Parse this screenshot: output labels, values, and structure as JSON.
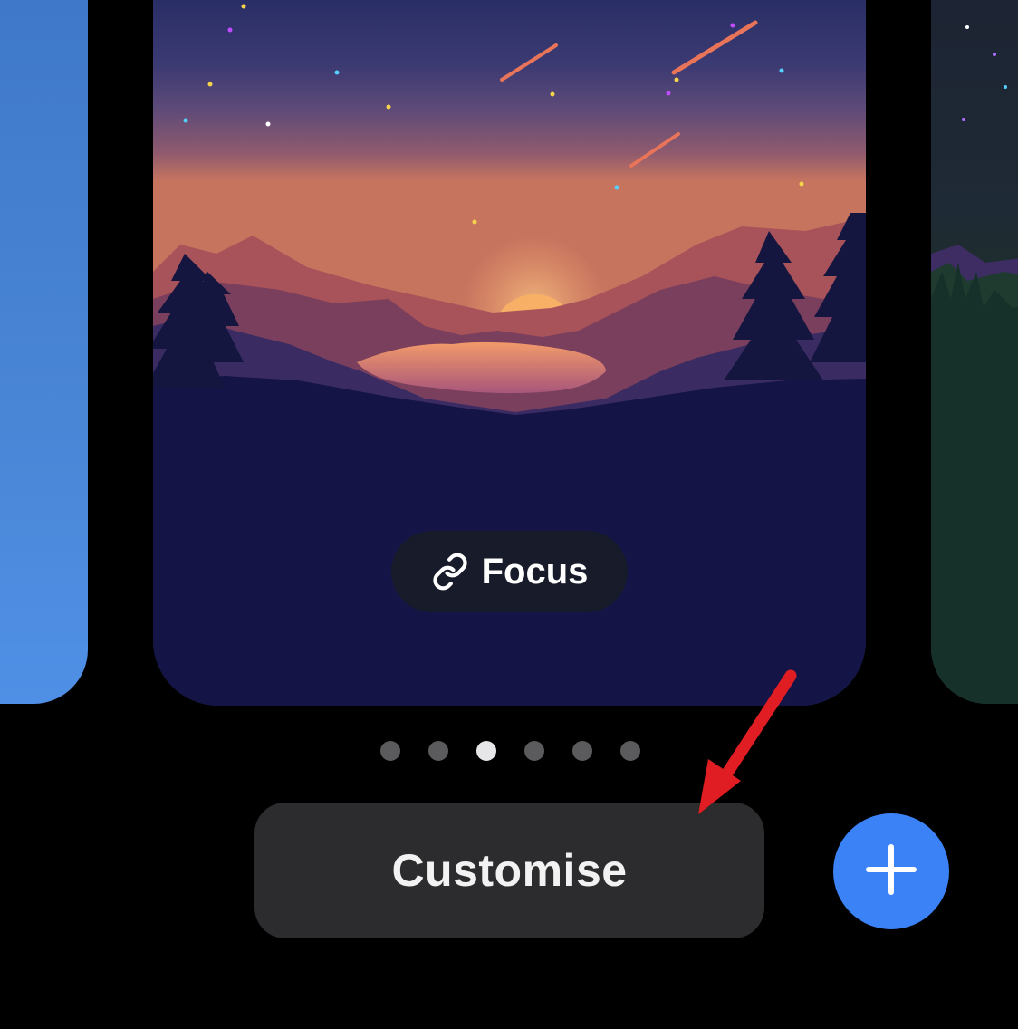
{
  "wallpaper_gallery": {
    "focus_label": "Focus",
    "page_indicator": {
      "count": 6,
      "active_index": 2
    },
    "customise_label": "Customise",
    "add_button_icon": "plus-icon",
    "focus_icon": "link-icon"
  },
  "colors": {
    "background": "#000000",
    "customise_button": "#2c2c2e",
    "add_button": "#3b82f6",
    "annotation_arrow": "#e11d24"
  }
}
